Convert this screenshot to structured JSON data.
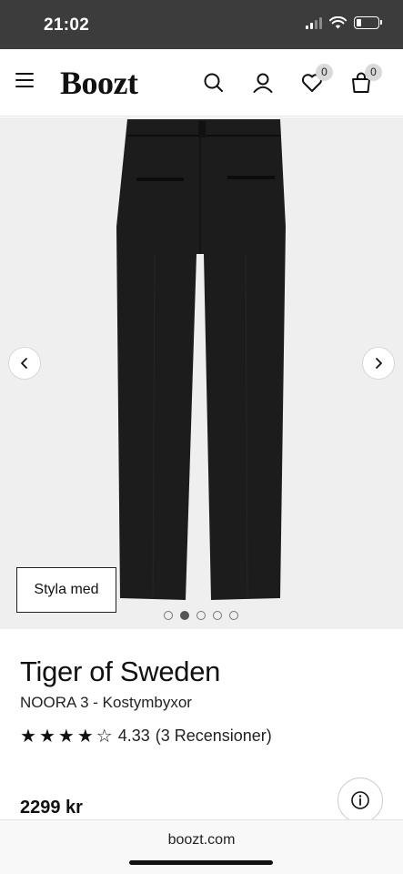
{
  "status_bar": {
    "time": "21:02"
  },
  "header": {
    "logo": "Boozt",
    "wishlist_count": "0",
    "cart_count": "0"
  },
  "gallery": {
    "style_button": "Styla med",
    "slide_count": 5,
    "active_slide": 2
  },
  "product": {
    "brand": "Tiger of Sweden",
    "name": "NOORA 3 - Kostymbyxor",
    "rating_value": "4.33",
    "rating_stars": 4,
    "rating_count": "(3 Recensioner)",
    "price": "2299 kr"
  },
  "browser": {
    "url": "boozt.com"
  }
}
